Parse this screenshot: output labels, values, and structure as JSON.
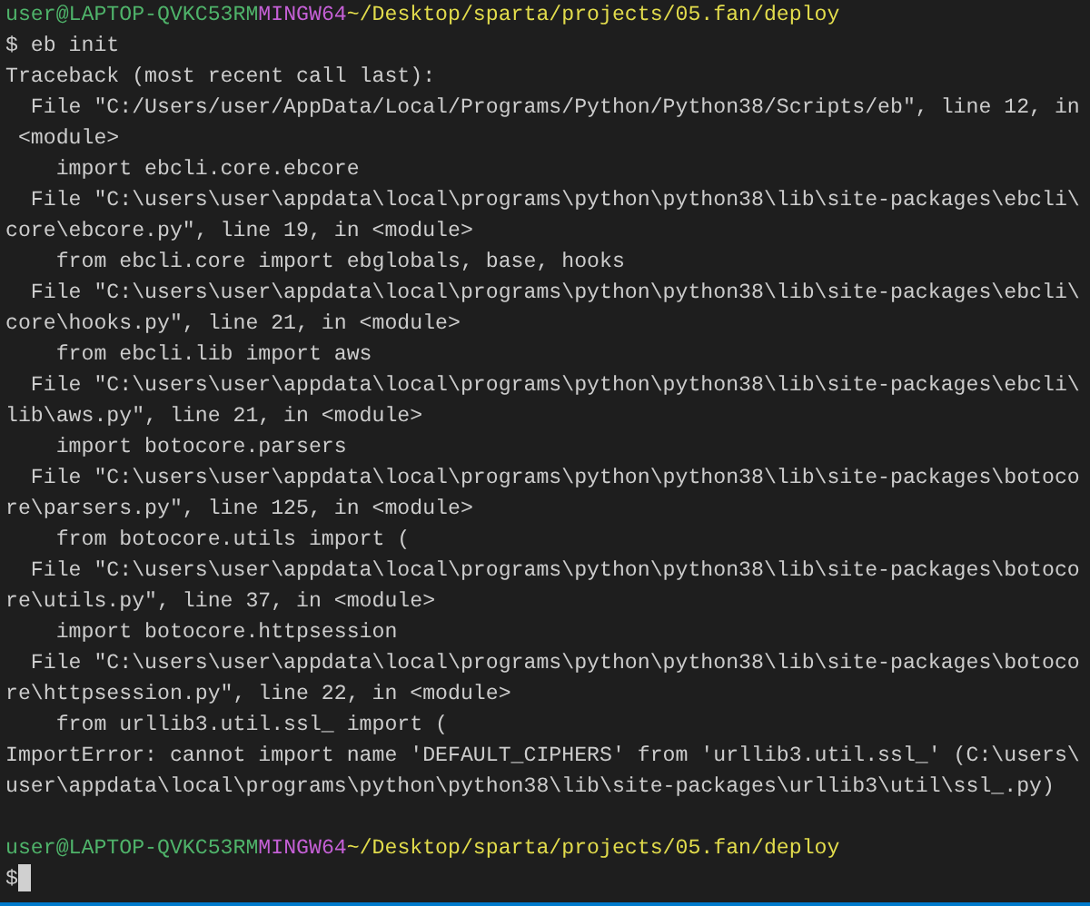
{
  "terminal": {
    "blocks": [
      {
        "kind": "prompt",
        "user_host": "user@LAPTOP-QVKC53RM",
        "shell": "MINGW64",
        "path": "~/Desktop/sparta/projects/05.fan/deploy"
      },
      {
        "kind": "command",
        "text": "$ eb init"
      },
      {
        "kind": "output",
        "lines": [
          "Traceback (most recent call last):",
          "  File \"C:/Users/user/AppData/Local/Programs/Python/Python38/Scripts/eb\", line 12, in",
          " <module>",
          "    import ebcli.core.ebcore",
          "  File \"C:\\users\\user\\appdata\\local\\programs\\python\\python38\\lib\\site-packages\\ebcli\\",
          "core\\ebcore.py\", line 19, in <module>",
          "    from ebcli.core import ebglobals, base, hooks",
          "  File \"C:\\users\\user\\appdata\\local\\programs\\python\\python38\\lib\\site-packages\\ebcli\\",
          "core\\hooks.py\", line 21, in <module>",
          "    from ebcli.lib import aws",
          "  File \"C:\\users\\user\\appdata\\local\\programs\\python\\python38\\lib\\site-packages\\ebcli\\",
          "lib\\aws.py\", line 21, in <module>",
          "    import botocore.parsers",
          "  File \"C:\\users\\user\\appdata\\local\\programs\\python\\python38\\lib\\site-packages\\botoco",
          "re\\parsers.py\", line 125, in <module>",
          "    from botocore.utils import (",
          "  File \"C:\\users\\user\\appdata\\local\\programs\\python\\python38\\lib\\site-packages\\botoco",
          "re\\utils.py\", line 37, in <module>",
          "    import botocore.httpsession",
          "  File \"C:\\users\\user\\appdata\\local\\programs\\python\\python38\\lib\\site-packages\\botoco",
          "re\\httpsession.py\", line 22, in <module>",
          "    from urllib3.util.ssl_ import (",
          "ImportError: cannot import name 'DEFAULT_CIPHERS' from 'urllib3.util.ssl_' (C:\\users\\",
          "user\\appdata\\local\\programs\\python\\python38\\lib\\site-packages\\urllib3\\util\\ssl_.py)"
        ]
      },
      {
        "kind": "blank"
      },
      {
        "kind": "prompt",
        "user_host": "user@LAPTOP-QVKC53RM",
        "shell": "MINGW64",
        "path": "~/Desktop/sparta/projects/05.fan/deploy"
      },
      {
        "kind": "input",
        "text": "$"
      }
    ]
  }
}
